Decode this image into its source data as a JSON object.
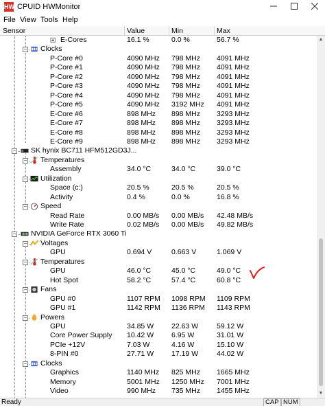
{
  "window": {
    "title": "CPUID HWMonitor",
    "icon_label": "HW",
    "minimize_icon": "minimize-icon",
    "maximize_icon": "maximize-icon",
    "close_icon": "close-icon"
  },
  "menu": [
    "File",
    "View",
    "Tools",
    "Help"
  ],
  "columns": {
    "sensor": "Sensor",
    "value": "Value",
    "min": "Min",
    "max": "Max"
  },
  "rows": [
    {
      "label": "E-Cores",
      "value": "16.1 %",
      "min": "0.0 %",
      "max": "56.7 %"
    },
    {
      "label": "Clocks"
    },
    {
      "label": "P-Core #0",
      "value": "4090 MHz",
      "min": "798 MHz",
      "max": "4091 MHz"
    },
    {
      "label": "P-Core #1",
      "value": "4090 MHz",
      "min": "798 MHz",
      "max": "4091 MHz"
    },
    {
      "label": "P-Core #2",
      "value": "4090 MHz",
      "min": "798 MHz",
      "max": "4091 MHz"
    },
    {
      "label": "P-Core #3",
      "value": "4090 MHz",
      "min": "798 MHz",
      "max": "4091 MHz"
    },
    {
      "label": "P-Core #4",
      "value": "4090 MHz",
      "min": "798 MHz",
      "max": "4091 MHz"
    },
    {
      "label": "P-Core #5",
      "value": "4090 MHz",
      "min": "3192 MHz",
      "max": "4091 MHz"
    },
    {
      "label": "E-Core #6",
      "value": "898 MHz",
      "min": "898 MHz",
      "max": "3293 MHz"
    },
    {
      "label": "E-Core #7",
      "value": "898 MHz",
      "min": "898 MHz",
      "max": "3293 MHz"
    },
    {
      "label": "E-Core #8",
      "value": "898 MHz",
      "min": "898 MHz",
      "max": "3293 MHz"
    },
    {
      "label": "E-Core #9",
      "value": "898 MHz",
      "min": "898 MHz",
      "max": "3293 MHz"
    },
    {
      "label": "SK hynix BC711 HFM512GD3J..."
    },
    {
      "label": "Temperatures"
    },
    {
      "label": "Assembly",
      "value": "34.0 °C",
      "min": "34.0 °C",
      "max": "39.0 °C"
    },
    {
      "label": "Utilization"
    },
    {
      "label": "Space (c:)",
      "value": "20.5 %",
      "min": "20.5 %",
      "max": "20.5 %"
    },
    {
      "label": "Activity",
      "value": "0.4 %",
      "min": "0.0 %",
      "max": "16.8 %"
    },
    {
      "label": "Speed"
    },
    {
      "label": "Read Rate",
      "value": "0.00 MB/s",
      "min": "0.00 MB/s",
      "max": "42.48 MB/s"
    },
    {
      "label": "Write Rate",
      "value": "0.02 MB/s",
      "min": "0.00 MB/s",
      "max": "49.82 MB/s"
    },
    {
      "label": "NVIDIA GeForce RTX 3060 Ti"
    },
    {
      "label": "Voltages"
    },
    {
      "label": "GPU",
      "value": "0.694 V",
      "min": "0.663 V",
      "max": "1.069 V"
    },
    {
      "label": "Temperatures"
    },
    {
      "label": "GPU",
      "value": "46.0 °C",
      "min": "45.0 °C",
      "max": "49.0 °C"
    },
    {
      "label": "Hot Spot",
      "value": "58.2 °C",
      "min": "57.4 °C",
      "max": "60.8 °C"
    },
    {
      "label": "Fans"
    },
    {
      "label": "GPU #0",
      "value": "1107 RPM",
      "min": "1098 RPM",
      "max": "1109 RPM"
    },
    {
      "label": "GPU #1",
      "value": "1142 RPM",
      "min": "1136 RPM",
      "max": "1143 RPM"
    },
    {
      "label": "Powers"
    },
    {
      "label": "GPU",
      "value": "34.85 W",
      "min": "22.63 W",
      "max": "59.12 W"
    },
    {
      "label": "Core Power Supply",
      "value": "10.42 W",
      "min": "6.95 W",
      "max": "31.01 W"
    },
    {
      "label": "PCIe +12V",
      "value": "7.03 W",
      "min": "4.16 W",
      "max": "15.10 W"
    },
    {
      "label": "8-PIN #0",
      "value": "27.71 W",
      "min": "17.19 W",
      "max": "44.02 W"
    },
    {
      "label": "Clocks"
    },
    {
      "label": "Graphics",
      "value": "1140 MHz",
      "min": "825 MHz",
      "max": "1665 MHz"
    },
    {
      "label": "Memory",
      "value": "5001 MHz",
      "min": "1250 MHz",
      "max": "7001 MHz"
    },
    {
      "label": "Video",
      "value": "990 MHz",
      "min": "735 MHz",
      "max": "1455 MHz"
    }
  ],
  "status": {
    "text": "Ready",
    "caps": "CAP",
    "num": "NUM"
  },
  "colors": {
    "annotation_mark": "#e0201a",
    "app_icon": "#d9342b"
  }
}
